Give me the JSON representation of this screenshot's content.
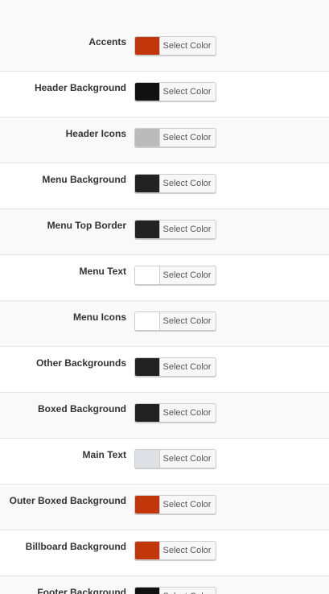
{
  "settings": {
    "button_label": "Select Color",
    "rows": [
      {
        "label": "Accents",
        "color": "#c1370b"
      },
      {
        "label": "Header Background",
        "color": "#111111"
      },
      {
        "label": "Header Icons",
        "color": "#bbbbbb"
      },
      {
        "label": "Menu Background",
        "color": "#222222"
      },
      {
        "label": "Menu Top Border",
        "color": "#222222"
      },
      {
        "label": "Menu Text",
        "color": "#ffffff"
      },
      {
        "label": "Menu Icons",
        "color": "#ffffff"
      },
      {
        "label": "Other Backgrounds",
        "color": "#222222"
      },
      {
        "label": "Boxed Background",
        "color": "#222222"
      },
      {
        "label": "Main Text",
        "color": "#dfdfe6"
      },
      {
        "label": "Outer Boxed Background",
        "color": "#c1370b"
      },
      {
        "label": "Billboard Background",
        "color": "#c1370b"
      },
      {
        "label": "Footer Background",
        "color": "#111111"
      }
    ]
  }
}
